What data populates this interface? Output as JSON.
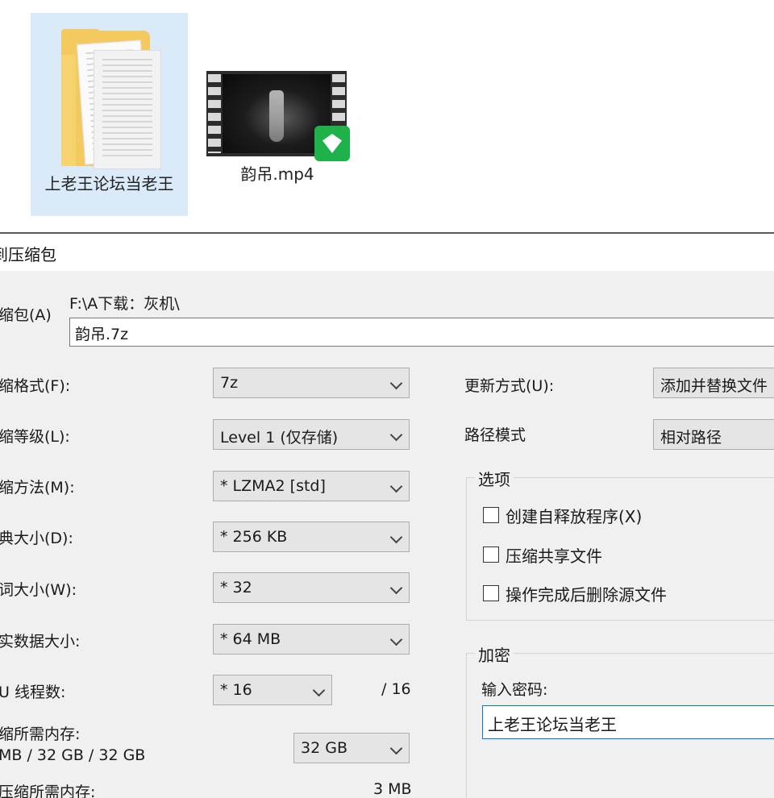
{
  "explorer": {
    "folder_label": "上老王论坛当老王",
    "video_label": "韵吊.mp4"
  },
  "dialog": {
    "title": "到压缩包",
    "archive_label": "缩包(A)",
    "archive_path": "F:\\A下载：灰机\\",
    "archive_name": "韵吊.7z",
    "format_label": "缩格式(F):",
    "format_value": "7z",
    "level_label": "缩等级(L):",
    "level_value": "Level 1 (仅存储)",
    "method_label": "缩方法(M):",
    "method_value": "* LZMA2 [std]",
    "dict_label": "典大小(D):",
    "dict_value": "* 256 KB",
    "word_label": "词大小(W):",
    "word_value": "* 32",
    "solid_label": "实数据大小:",
    "solid_value": "* 64 MB",
    "threads_label": "U 线程数:",
    "threads_value": "* 16",
    "threads_max": "/ 16",
    "mem_comp_label": "缩所需内存:",
    "mem_comp_value": "MB / 32 GB / 32 GB",
    "mem_select_value": "32 GB",
    "mem_decomp_label": "压缩所需内存:",
    "mem_decomp_value": "3 MB",
    "update_label": "更新方式(U):",
    "update_value": "添加并替换文件",
    "pathmode_label": "路径模式",
    "pathmode_value": "相对路径",
    "options_title": "选项",
    "opt_sfx": "创建自释放程序(X)",
    "opt_shared": "压缩共享文件",
    "opt_delete": "操作完成后删除源文件",
    "encrypt_title": "加密",
    "password_label": "输入密码:",
    "password_value": "上老王论坛当老王"
  }
}
